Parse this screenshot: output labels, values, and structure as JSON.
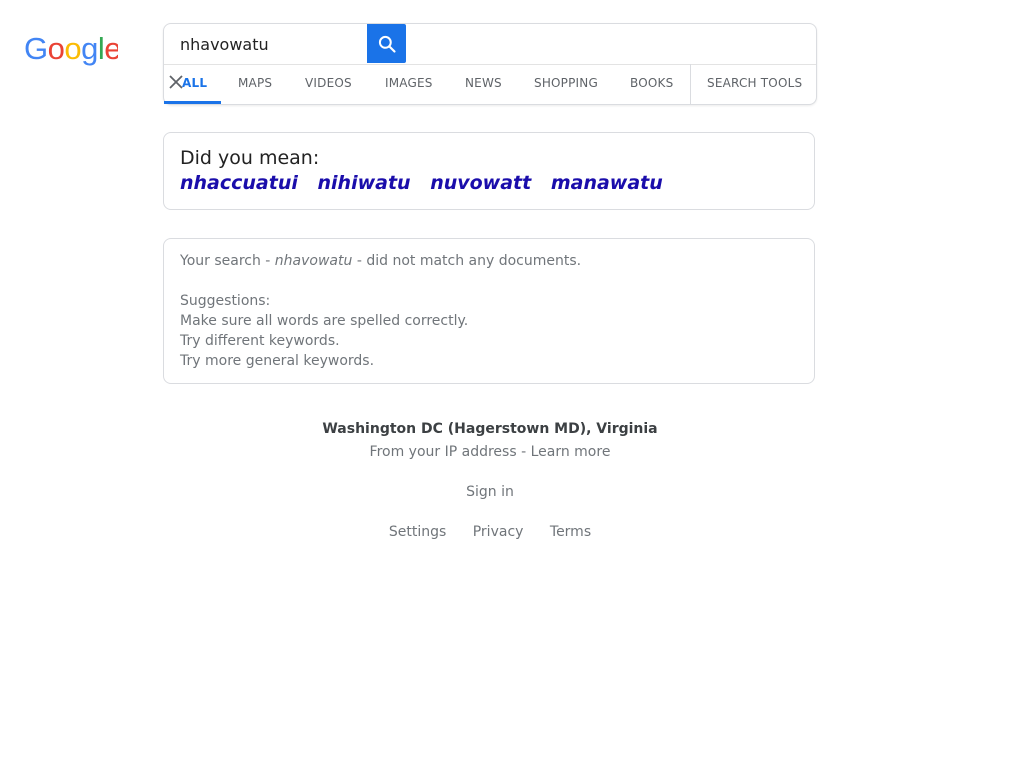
{
  "logo": {
    "text": "Google"
  },
  "search": {
    "query": "nhavowatu"
  },
  "tabs": [
    {
      "label": "ALL",
      "active": true
    },
    {
      "label": "MAPS"
    },
    {
      "label": "VIDEOS"
    },
    {
      "label": "IMAGES"
    },
    {
      "label": "NEWS"
    },
    {
      "label": "SHOPPING"
    },
    {
      "label": "BOOKS"
    },
    {
      "label": "SEARCH TOOLS"
    }
  ],
  "did_you_mean": {
    "title": "Did you mean:",
    "suggestions": [
      "nhaccuatui",
      "nihiwatu",
      "nuvowatt",
      "manawatu"
    ]
  },
  "no_match": {
    "prefix": "Your search - ",
    "query": "nhavowatu",
    "suffix": " - did not match any documents.",
    "suggestions_title": "Suggestions:",
    "tips": [
      "Make sure all words are spelled correctly.",
      "Try different keywords.",
      "Try more general keywords."
    ]
  },
  "location": {
    "place": "Washington DC (Hagerstown MD), Virginia",
    "source": "From your IP address",
    "separator": " - ",
    "learn_more": "Learn more"
  },
  "footer": {
    "sign_in": "Sign in",
    "settings": "Settings",
    "privacy": "Privacy",
    "terms": "Terms"
  },
  "colors": {
    "accent": "#1a73e8",
    "link": "#1a0dab",
    "muted": "#70757a"
  }
}
